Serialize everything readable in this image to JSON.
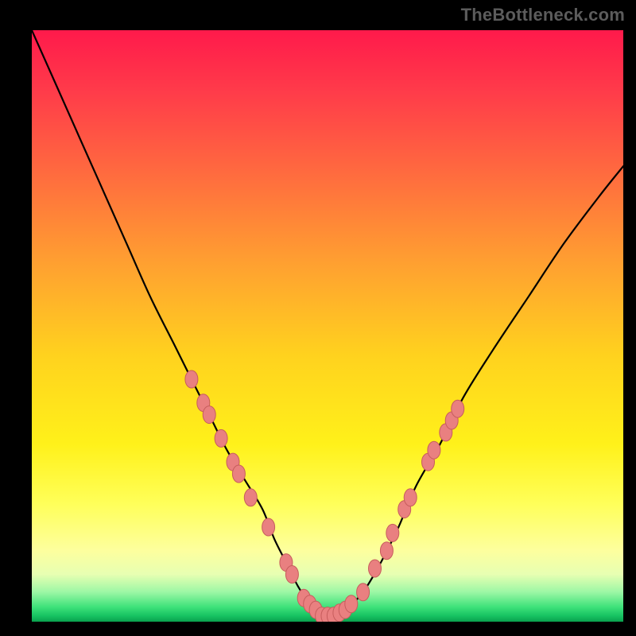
{
  "watermark": "TheBottleneck.com",
  "colors": {
    "background": "#000000",
    "gradient_top": "#ff1a4b",
    "gradient_mid": "#fff11a",
    "gradient_bottom": "#0aa24e",
    "curve": "#000000",
    "marker_fill": "#e98080",
    "marker_stroke": "#c75d5d"
  },
  "chart_data": {
    "type": "line",
    "title": "",
    "xlabel": "",
    "ylabel": "",
    "xlim": [
      0,
      100
    ],
    "ylim": [
      0,
      100
    ],
    "series": [
      {
        "name": "bottleneck-curve",
        "x": [
          0,
          4,
          8,
          12,
          16,
          20,
          24,
          27,
          30,
          33,
          36,
          39,
          41,
          43,
          45,
          47,
          49,
          51,
          53,
          56,
          59,
          62,
          65,
          69,
          73,
          78,
          84,
          90,
          96,
          100
        ],
        "y": [
          100,
          91,
          82,
          73,
          64,
          55,
          47,
          41,
          35,
          29,
          24,
          19,
          14,
          10,
          6,
          3,
          1,
          1,
          2,
          5,
          10,
          16,
          23,
          30,
          38,
          46,
          55,
          64,
          72,
          77
        ]
      }
    ],
    "markers": {
      "name": "highlighted-points",
      "points": [
        {
          "x": 27,
          "y": 41
        },
        {
          "x": 29,
          "y": 37
        },
        {
          "x": 30,
          "y": 35
        },
        {
          "x": 32,
          "y": 31
        },
        {
          "x": 34,
          "y": 27
        },
        {
          "x": 35,
          "y": 25
        },
        {
          "x": 37,
          "y": 21
        },
        {
          "x": 40,
          "y": 16
        },
        {
          "x": 43,
          "y": 10
        },
        {
          "x": 44,
          "y": 8
        },
        {
          "x": 46,
          "y": 4
        },
        {
          "x": 47,
          "y": 3
        },
        {
          "x": 48,
          "y": 2
        },
        {
          "x": 49,
          "y": 1
        },
        {
          "x": 50,
          "y": 1
        },
        {
          "x": 51,
          "y": 1
        },
        {
          "x": 52,
          "y": 1.5
        },
        {
          "x": 53,
          "y": 2
        },
        {
          "x": 54,
          "y": 3
        },
        {
          "x": 56,
          "y": 5
        },
        {
          "x": 58,
          "y": 9
        },
        {
          "x": 60,
          "y": 12
        },
        {
          "x": 61,
          "y": 15
        },
        {
          "x": 63,
          "y": 19
        },
        {
          "x": 64,
          "y": 21
        },
        {
          "x": 67,
          "y": 27
        },
        {
          "x": 68,
          "y": 29
        },
        {
          "x": 70,
          "y": 32
        },
        {
          "x": 71,
          "y": 34
        },
        {
          "x": 72,
          "y": 36
        }
      ]
    }
  }
}
